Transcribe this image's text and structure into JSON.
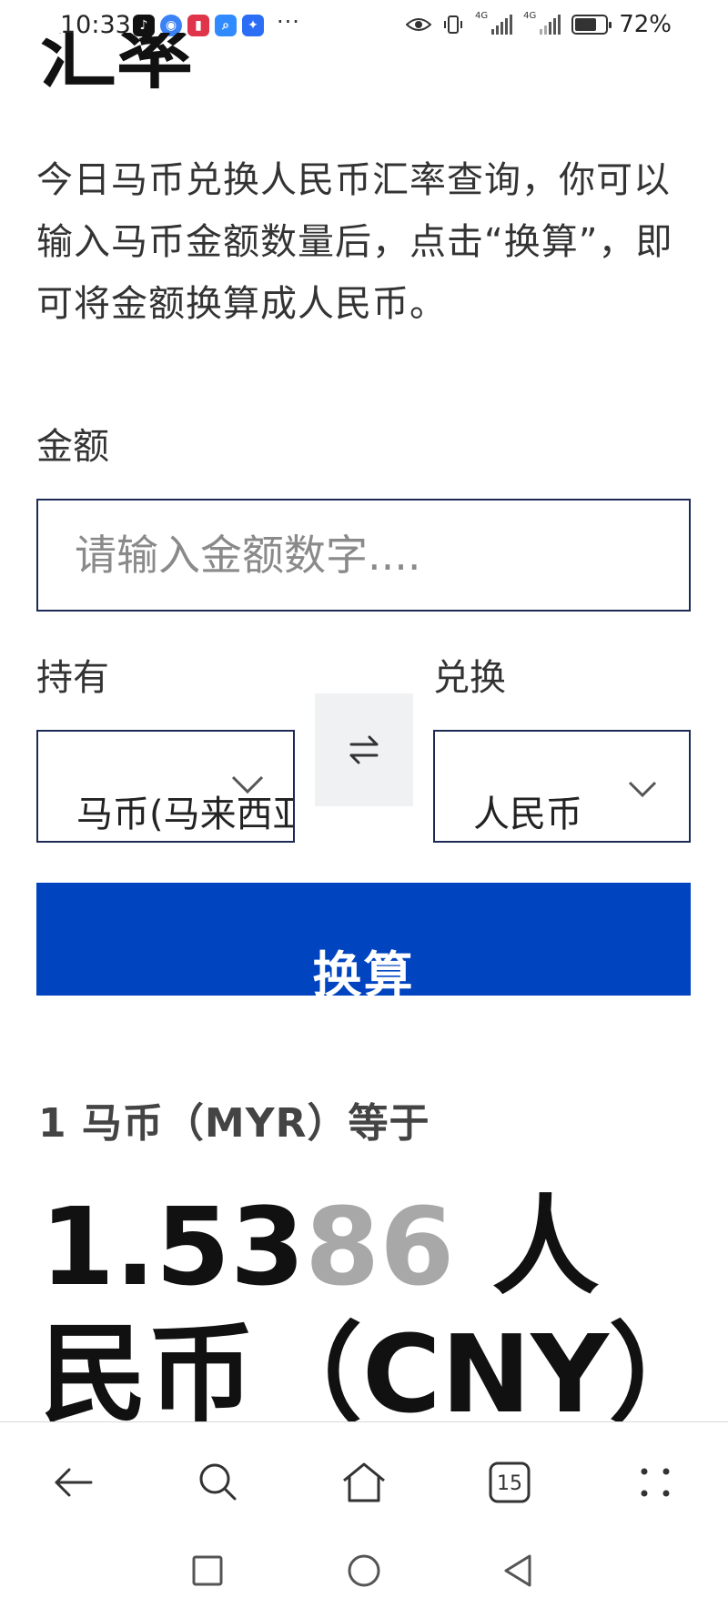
{
  "status_bar": {
    "time": "10:33",
    "app_icons": [
      "tiktok-icon",
      "compass-app-icon",
      "book-app-icon",
      "search-app-icon",
      "lightbulb-app-icon"
    ],
    "overflow_dots": "···",
    "network_left": "4G",
    "network_right": "4G",
    "battery_percent_text": "72%",
    "battery_level": 0.72
  },
  "page": {
    "partial_title": "汇率",
    "description": "今日马币兑换人民币汇率查询，你可以输入马币金额数量后，点击“换算”，即可将金额换算成人民币。"
  },
  "form": {
    "amount_label": "金额",
    "amount_placeholder": "请输入金额数字....",
    "amount_value": "",
    "from_label": "持有",
    "to_label": "兑换",
    "from_currency": "马币(马来西亚林吉特)",
    "to_currency": "人民币",
    "convert_button": "换算"
  },
  "result": {
    "rate_label": "1 马币（MYR）等于",
    "rate_value_strong": "1.53",
    "rate_value_faded": "86",
    "rate_currency": " 人民币（CNY）"
  },
  "browser_toolbar": {
    "tab_count": "15",
    "items": [
      "back-arrow-icon",
      "search-icon",
      "home-icon",
      "tabs-icon",
      "more-dots-icon"
    ]
  },
  "system_nav": {
    "items": [
      "recent-apps-icon",
      "home-circle-icon",
      "back-triangle-icon"
    ]
  },
  "colors": {
    "primary_button": "#0044c0",
    "border": "#1c2a55",
    "faded_digits": "#a8a8a8"
  }
}
